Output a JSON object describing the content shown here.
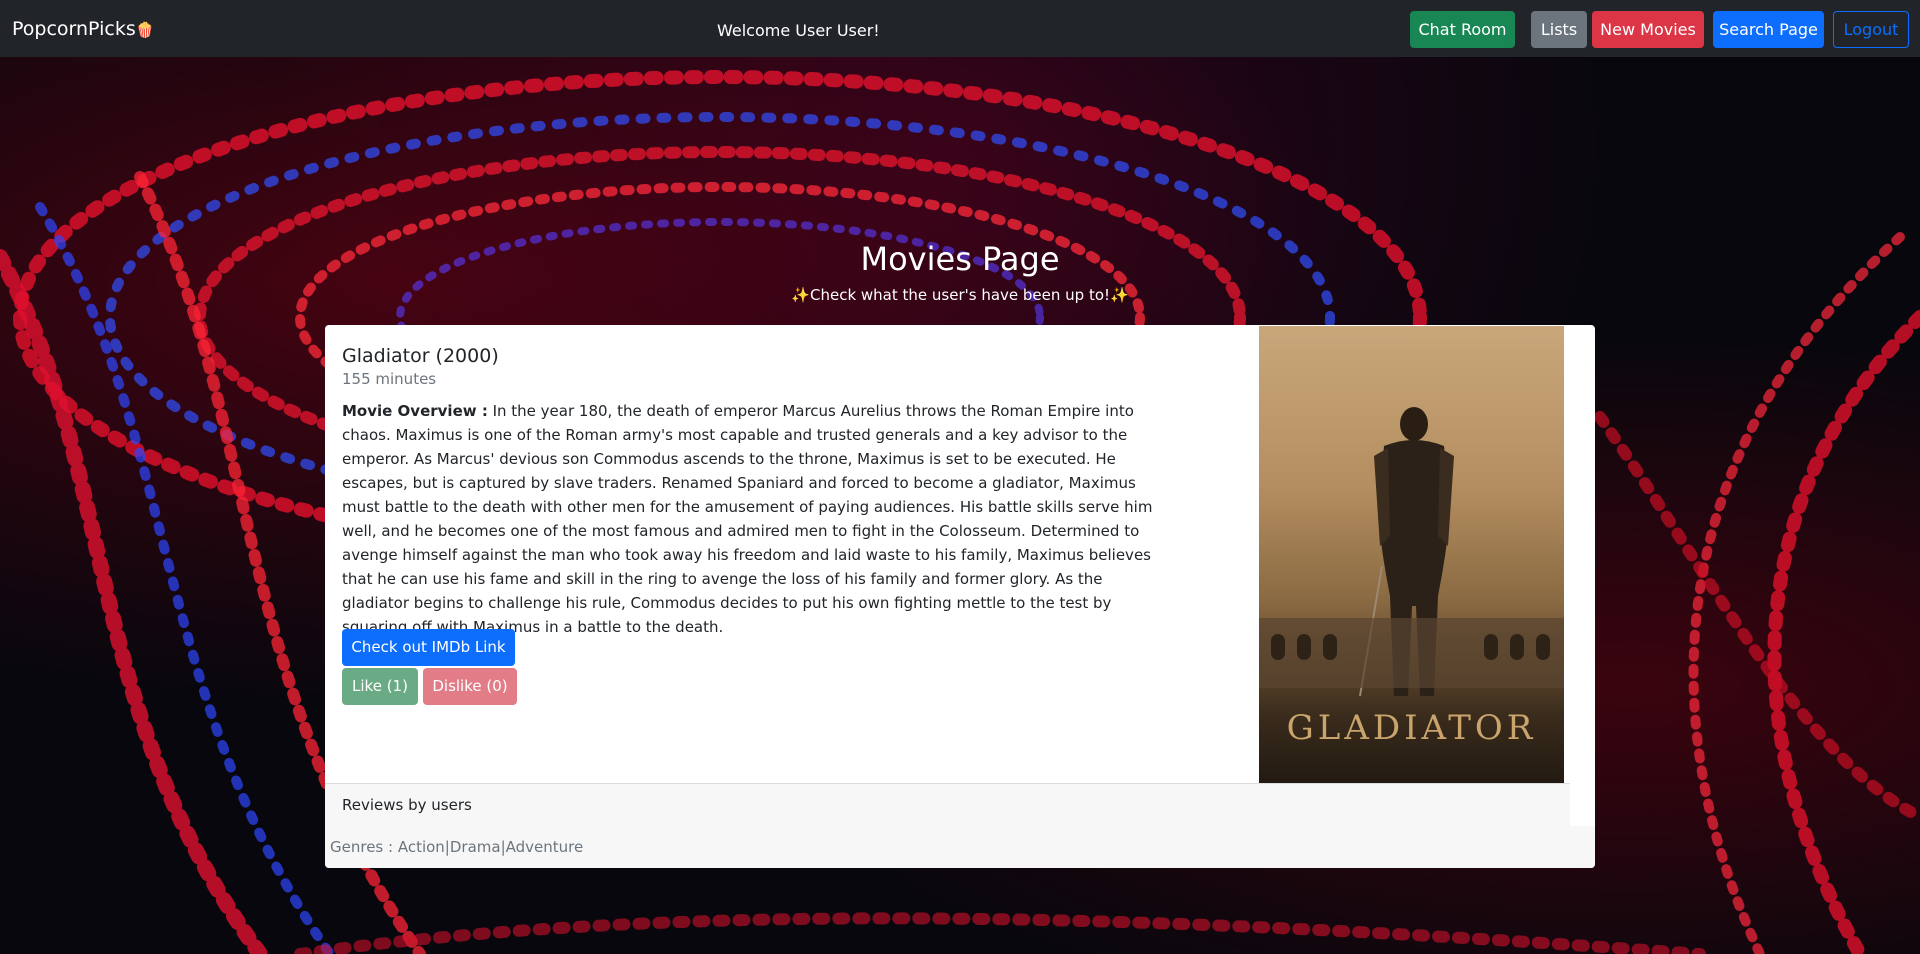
{
  "navbar": {
    "brand": "PopcornPicks",
    "brand_icon": "popcorn-icon",
    "welcome": "Welcome User User!",
    "buttons": {
      "chat_room": "Chat Room",
      "lists": "Lists",
      "new_movies": "New Movies",
      "search_page": "Search Page",
      "logout": "Logout"
    }
  },
  "header": {
    "title": "Movies Page",
    "subtitle": "Check what the user's have been up to!",
    "subtitle_icon": "sparkles-icon"
  },
  "movie": {
    "title": "Gladiator (2000)",
    "runtime": "155 minutes",
    "overview_label": "Movie Overview :",
    "overview": " In the year 180, the death of emperor Marcus Aurelius throws the Roman Empire into chaos. Maximus is one of the Roman army's most capable and trusted generals and a key advisor to the emperor. As Marcus' devious son Commodus ascends to the throne, Maximus is set to be executed. He escapes, but is captured by slave traders. Renamed Spaniard and forced to become a gladiator, Maximus must battle to the death with other men for the amusement of paying audiences. His battle skills serve him well, and he becomes one of the most famous and admired men to fight in the Colosseum. Determined to avenge himself against the man who took away his freedom and laid waste to his family, Maximus believes that he can use his fame and skill in the ring to avenge the loss of his family and former glory. As the gladiator begins to challenge his rule, Commodus decides to put his own fighting mettle to the test by squaring off with Maximus in a battle to the death.",
    "imdb_button": "Check out IMDb Link",
    "like_button": "Like (1)",
    "dislike_button": "Dislike (0)",
    "poster_text": "GLADIATOR",
    "reviews_header": "Reviews by users",
    "genres": "Genres : Action|Drama|Adventure"
  },
  "colors": {
    "navbar_bg": "#212529",
    "chat_room": "#198754",
    "lists": "#6c757d",
    "new_movies": "#dc3545",
    "search_page": "#0d6efd",
    "like": "#6aab86",
    "dislike": "#e27d87"
  }
}
